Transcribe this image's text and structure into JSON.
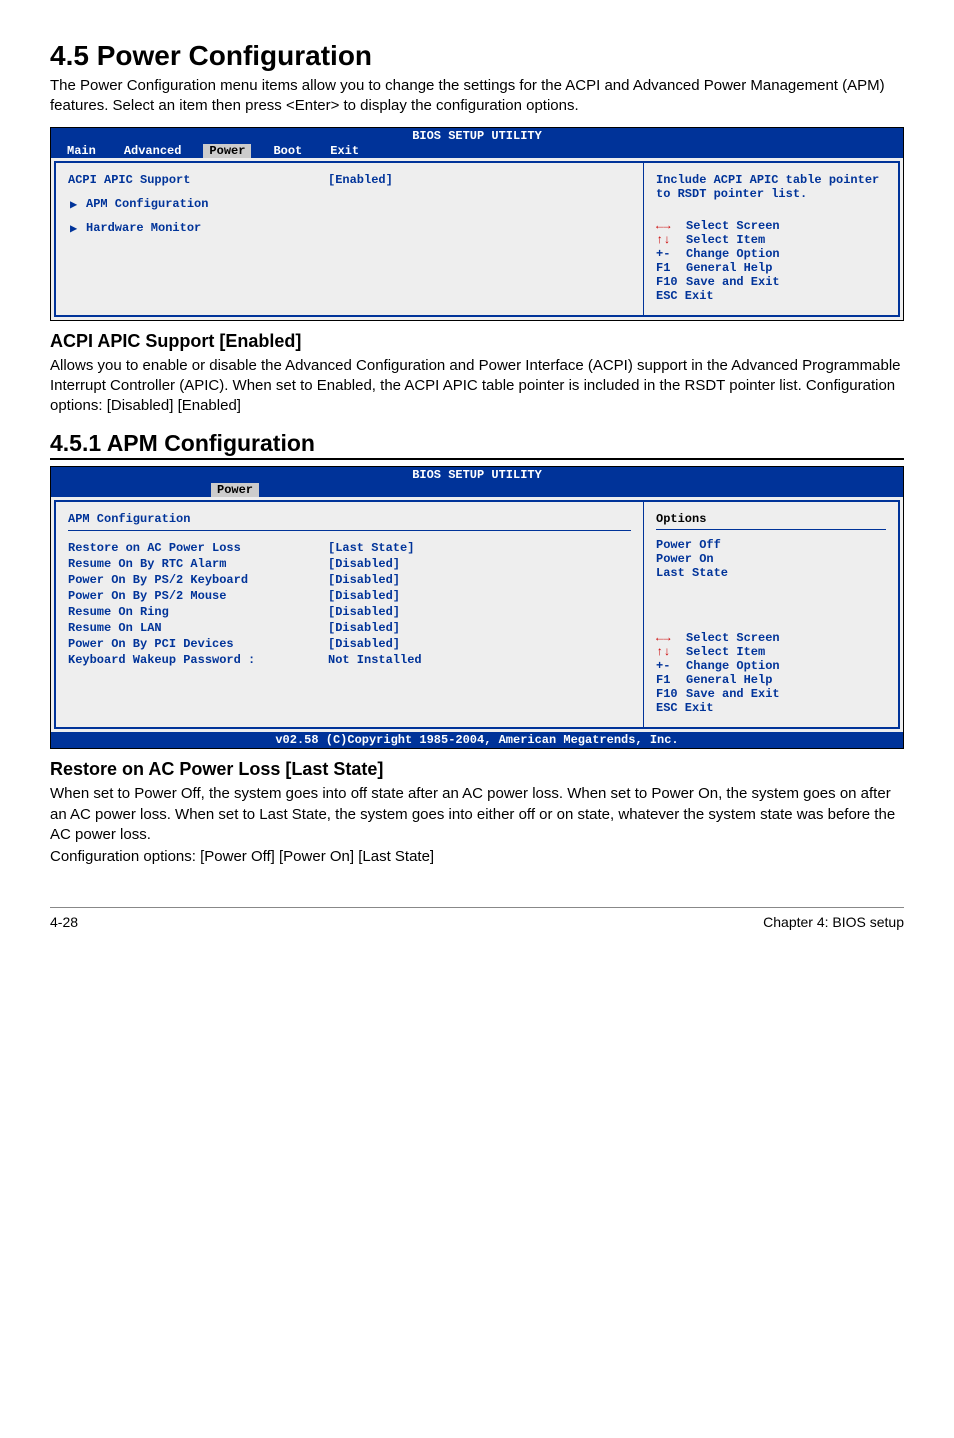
{
  "section": {
    "title": "4.5 Power Configuration",
    "intro": "The Power Configuration menu items allow you to change the settings for the ACPI and Advanced Power Management (APM) features. Select an item then press <Enter> to display the configuration options."
  },
  "bios1": {
    "header": "BIOS SETUP UTILITY",
    "tabs": [
      "Main",
      "Advanced",
      "Power",
      "Boot",
      "Exit"
    ],
    "active_tab": "Power",
    "items": {
      "acpi_label": "ACPI APIC Support",
      "acpi_value": "[Enabled]",
      "apm_label": "APM Configuration",
      "hw_label": "Hardware Monitor"
    },
    "help_text": "Include ACPI APIC table pointer to RSDT pointer list.",
    "keys": {
      "select_screen": "Select Screen",
      "select_item": "Select Item",
      "change_option": "Change Option",
      "general_help": "General Help",
      "save_exit": "Save and Exit",
      "exit": "ESC Exit",
      "k_arrows_h": "←→",
      "k_arrows_v": "↑↓",
      "k_plusminus": "+-",
      "k_f1": "F1",
      "k_f10": "F10"
    }
  },
  "acpi_section": {
    "heading": "ACPI APIC Support [Enabled]",
    "body": "Allows you to enable or disable the Advanced Configuration and Power Interface (ACPI) support in the Advanced Programmable Interrupt Controller (APIC). When set to Enabled, the ACPI APIC table pointer is included in the RSDT pointer list. Configuration options: [Disabled] [Enabled]"
  },
  "apm_heading": "4.5.1 APM Configuration",
  "bios2": {
    "header": "BIOS SETUP UTILITY",
    "active_tab": "Power",
    "title": "APM Configuration",
    "items": [
      {
        "label": "Restore on AC Power Loss",
        "value": "[Last State]"
      },
      {
        "label": "Resume On By RTC Alarm",
        "value": "[Disabled]"
      },
      {
        "label": "Power On By PS/2 Keyboard",
        "value": "[Disabled]"
      },
      {
        "label": "Power On By PS/2 Mouse",
        "value": "[Disabled]"
      },
      {
        "label": "Resume On Ring",
        "value": "[Disabled]"
      },
      {
        "label": "Resume On LAN",
        "value": "[Disabled]"
      },
      {
        "label": "Power On By PCI Devices",
        "value": "[Disabled]"
      },
      {
        "label": " Keyboard Wakeup Password :",
        "value": "Not Installed"
      }
    ],
    "options_header": "Options",
    "options": [
      "Power Off",
      "Power On",
      "Last State"
    ],
    "keys": {
      "select_screen": "Select Screen",
      "select_item": "Select Item",
      "change_option": "Change Option",
      "general_help": "General Help",
      "save_exit": "Save and Exit",
      "exit": "ESC Exit",
      "k_arrows_h": "←→",
      "k_arrows_v": "↑↓",
      "k_plusminus": "+-",
      "k_f1": "F1",
      "k_f10": "F10"
    },
    "footer": "v02.58 (C)Copyright 1985-2004, American Megatrends, Inc."
  },
  "restore_section": {
    "heading": "Restore on AC Power Loss [Last State]",
    "body": "When set to Power Off, the system goes into off state after an AC power loss. When set to Power On, the system goes on after an AC power loss. When set to Last State, the system goes into either off or on state, whatever the system state was before the AC power loss.",
    "config": "Configuration options: [Power Off] [Power On] [Last State]"
  },
  "footer": {
    "left": "4-28",
    "right": "Chapter 4: BIOS setup"
  }
}
